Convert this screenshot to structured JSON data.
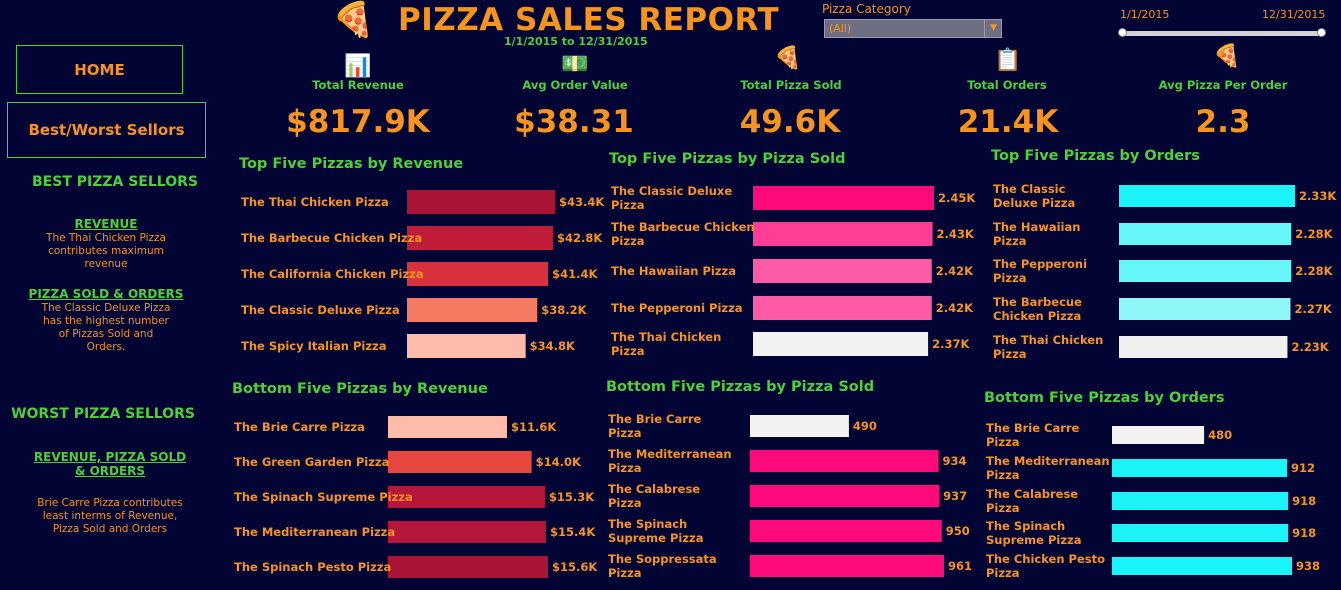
{
  "header": {
    "title": "PIZZA SALES REPORT",
    "date_range": "1/1/2015 to 12/31/2015",
    "logo_icon": "pizza-slice-icon"
  },
  "filters": {
    "category_label": "Pizza Category",
    "category_value": "(All)",
    "date_start": "1/1/2015",
    "date_end": "12/31/2015"
  },
  "nav": {
    "home": "HOME",
    "best_worst": "Best/Worst Sellors"
  },
  "sidebar": {
    "best_heading": "BEST PIZZA SELLORS",
    "revenue_link": "REVENUE",
    "revenue_text": "The Thai Chicken Pizza contributes maximum revenue",
    "sold_orders_link": "PIZZA SOLD & ORDERS",
    "sold_orders_text": "The Classic Deluxe Pizza has the highest number of Pizzas Sold and Orders.",
    "worst_heading": "WORST PIZZA SELLORS",
    "worst_link": "REVENUE, PIZZA SOLD & ORDERS",
    "worst_text": "Brie Carre Pizza contributes least interms of Revenue, Pizza Sold and Orders"
  },
  "kpis": [
    {
      "label": "Total Revenue",
      "value": "$817.9K",
      "icon": "bar-chart-icon"
    },
    {
      "label": "Avg Order Value",
      "value": "$38.31",
      "icon": "money-icon"
    },
    {
      "label": "Total Pizza Sold",
      "value": "49.6K",
      "icon": "pizza-slice-icon"
    },
    {
      "label": "Total Orders",
      "value": "21.4K",
      "icon": "order-list-icon"
    },
    {
      "label": "Avg Pizza Per Order",
      "value": "2.3",
      "icon": "pizza-slice-icon"
    }
  ],
  "chart_data": [
    {
      "type": "bar",
      "title": "Top Five Pizzas by Revenue",
      "categories": [
        "The Thai Chicken Pizza",
        "The Barbecue Chicken Pizza",
        "The California Chicken Pizza",
        "The Classic Deluxe Pizza",
        "The Spicy Italian Pizza"
      ],
      "values": [
        43.4,
        42.8,
        41.4,
        38.2,
        34.8
      ],
      "labels": [
        "$43.4K",
        "$42.8K",
        "$41.4K",
        "$38.2K",
        "$34.8K"
      ],
      "colors": [
        "#a91435",
        "#c01c3a",
        "#d8323f",
        "#f47b62",
        "#fdbbaa"
      ]
    },
    {
      "type": "bar",
      "title": "Top Five Pizzas by Pizza Sold",
      "categories": [
        "The Classic Deluxe Pizza",
        "The Barbecue Chicken Pizza",
        "The Hawaiian Pizza",
        "The Pepperoni Pizza",
        "The Thai Chicken Pizza"
      ],
      "values": [
        2.45,
        2.43,
        2.42,
        2.42,
        2.37
      ],
      "labels": [
        "2.45K",
        "2.43K",
        "2.42K",
        "2.42K",
        "2.37K"
      ],
      "colors": [
        "#ff0a7a",
        "#ff3d94",
        "#ff5aa5",
        "#ff5aa5",
        "#f2f2f2"
      ]
    },
    {
      "type": "bar",
      "title": "Top Five Pizzas by Orders",
      "categories": [
        "The Classic Deluxe Pizza",
        "The Hawaiian Pizza",
        "The Pepperoni Pizza",
        "The Barbecue Chicken Pizza",
        "The Thai Chicken Pizza"
      ],
      "values": [
        2.33,
        2.28,
        2.28,
        2.27,
        2.23
      ],
      "labels": [
        "2.33K",
        "2.28K",
        "2.28K",
        "2.27K",
        "2.23K"
      ],
      "colors": [
        "#1af3f7",
        "#66f6f8",
        "#66f6f8",
        "#8ef7f8",
        "#f0f0f0"
      ]
    },
    {
      "type": "bar",
      "title": "Bottom Five Pizzas by Revenue",
      "categories": [
        "The Brie Carre Pizza",
        "The Green Garden Pizza",
        "The Spinach Supreme Pizza",
        "The Mediterranean Pizza",
        "The Spinach Pesto Pizza"
      ],
      "values": [
        11.6,
        14.0,
        15.3,
        15.4,
        15.6
      ],
      "labels": [
        "$11.6K",
        "$14.0K",
        "$15.3K",
        "$15.4K",
        "$15.6K"
      ],
      "colors": [
        "#fdbbaa",
        "#e8473f",
        "#b5163a",
        "#b5163a",
        "#a91435"
      ]
    },
    {
      "type": "bar",
      "title": "Bottom Five Pizzas by Pizza Sold",
      "categories": [
        "The Brie Carre Pizza",
        "The Mediterranean Pizza",
        "The Calabrese Pizza",
        "The Spinach Supreme Pizza",
        "The Soppressata Pizza"
      ],
      "values": [
        490,
        934,
        937,
        950,
        961
      ],
      "labels": [
        "490",
        "934",
        "937",
        "950",
        "961"
      ],
      "colors": [
        "#f2f2f2",
        "#ff0a7a",
        "#ff0a7a",
        "#ff0a7a",
        "#ff0a7a"
      ]
    },
    {
      "type": "bar",
      "title": "Bottom Five Pizzas by Orders",
      "categories": [
        "The Brie Carre Pizza",
        "The Mediterranean Pizza",
        "The Calabrese Pizza",
        "The Spinach Supreme Pizza",
        "The Chicken Pesto Pizza"
      ],
      "values": [
        480,
        912,
        918,
        918,
        938
      ],
      "labels": [
        "480",
        "912",
        "918",
        "918",
        "938"
      ],
      "colors": [
        "#f2f2f2",
        "#1af3f7",
        "#1af3f7",
        "#1af3f7",
        "#1af3f7"
      ]
    }
  ]
}
